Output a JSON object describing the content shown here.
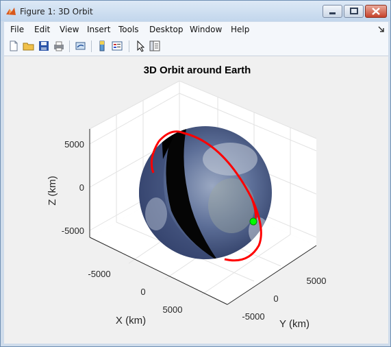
{
  "window": {
    "title": "Figure 1: 3D Orbit"
  },
  "menu": [
    "File",
    "Edit",
    "View",
    "Insert",
    "Tools",
    "Desktop",
    "Window",
    "Help"
  ],
  "toolbar": {
    "icons": [
      "new-figure-icon",
      "open-file-icon",
      "save-icon",
      "print-icon",
      "link-plot-icon",
      "insert-colorbar-icon",
      "insert-legend-icon",
      "edit-plot-icon",
      "plot-browser-icon"
    ]
  },
  "colors": {
    "orbit": "#ff0000",
    "satellite": "#00ff00",
    "earth_land": "#6b7fa8",
    "earth_night": "#0a0a0a"
  },
  "chart_data": {
    "type": "line3d",
    "title": "3D Orbit around Earth",
    "xlabel": "X (km)",
    "ylabel": "Y (km)",
    "zlabel": "Z (km)",
    "x_ticks": [
      "-5000",
      "0",
      "5000"
    ],
    "y_ticks": [
      "-5000",
      "0",
      "5000"
    ],
    "z_ticks": [
      "5000",
      "0",
      "-5000"
    ],
    "grid": true,
    "series": [
      {
        "kind": "surface",
        "description_id": "earth-sphere",
        "radius_km": 6371
      },
      {
        "kind": "orbit-line",
        "radius_km": 7000,
        "color": "#ff0000"
      },
      {
        "kind": "marker",
        "color": "#00ff00"
      }
    ]
  }
}
